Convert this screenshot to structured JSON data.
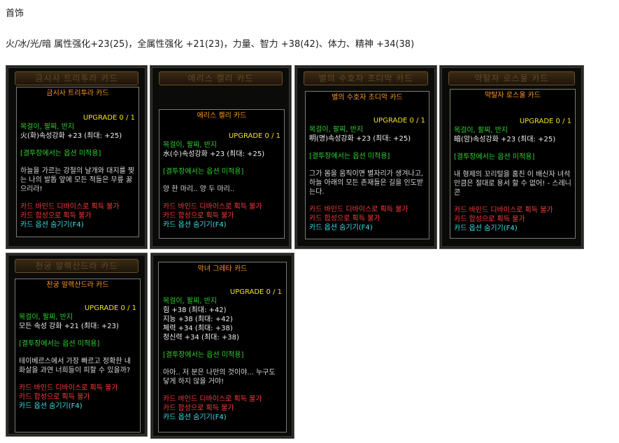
{
  "heading": "首饰",
  "summary": "火/冰/光/暗 属性强化+23(25)，全属性强化 +21(23)，力量、智力 +38(42)、体力、精神 +34(38)",
  "cards": [
    {
      "frame_title": "금시사 트리투라 카드",
      "name": "금시사 트리투라 카드",
      "upgrade": "UPGRADE 0 / 1",
      "slots": "목걸이, 팔찌, 반지",
      "stats": [
        "火(화)속성강화 +23 (최대: +25)"
      ],
      "note": "[결투장에서는 옵션 미적용]",
      "desc": "하늘을 가르는 강철의 날개와 대지를 찢는 나의 발톱 앞에 모든 적들은 무릎 꿇으리라!",
      "bind": "카드 바인드 디바이스로 획득 불가",
      "synth": "카드 합성으로 획득 불가",
      "hide": "카드 옵션 숨기기(F4)"
    },
    {
      "frame_title": "에리스 켈리 카드",
      "name": "에리스 켈리 카드",
      "upgrade": "UPGRADE 0 / 1",
      "slots": "목걸이, 팔찌, 반지",
      "stats": [
        "水(수)속성강화 +23 (최대: +25)"
      ],
      "note": "[결투장에서는 옵션 미적용]",
      "desc": "양 한 마리.. 양 두 마리..",
      "bind": "카드 바인드 디바이스로 획득 불가",
      "synth": "카드 합성으로 획득 불가",
      "hide": "카드 옵션 숨기기(F4)"
    },
    {
      "frame_title": "별의 수호자 조디악 카드",
      "name": "별의 수호자 조디악 카드",
      "upgrade": "UPGRADE 0 / 1",
      "slots": "목걸이, 팔찌, 반지",
      "stats": [
        "明(명)속성강화 +23 (최대: +25)"
      ],
      "note": "[결투장에서는 옵션 미적용]",
      "desc": "그가 몸을 움직이면 별자리가 생겨나고, 하늘 아래의 모든 존재들은 길을 인도받는다.",
      "bind": "카드 바인드 디바이스로 획득 불가",
      "synth": "카드 합성으로 획득 불가",
      "hide": "카드 옵션 숨기기(F4)"
    },
    {
      "frame_title": "약탈자 로스울 카드",
      "name": "약탈자 로스울 카드",
      "upgrade": "UPGRADE 0 / 1",
      "slots": "목걸이, 팔찌, 반지",
      "stats": [
        "暗(암)속성강화 +23 (최대: +25)"
      ],
      "note": "[결투장에서는 옵션 미적용]",
      "desc": "내 형제의 꼬리털을 훔친 이 배신자 녀석만큼은 절대로 용서 할 수 없어! - 스레니콘",
      "bind": "카드 바인드 디바이스로 획득 불가",
      "synth": "카드 합성으로 획득 불가",
      "hide": "카드 옵션 숨기기(F4)"
    },
    {
      "frame_title": "천궁 알렉산드라 카드",
      "name": "천궁 알렉산드라 카드",
      "upgrade": "UPGRADE 0 / 1",
      "slots": "목걸이, 팔찌, 반지",
      "stats": [
        "모든 속성 강화 +21 (최대: +23)"
      ],
      "note": "[결투장에서는 옵션 미적용]",
      "desc": "테이베르스에서 가장 빠르고 정확한 내 화살을 과연 너희들이 피할 수 있을까?",
      "bind": "카드 바인드 디바이스로 획득 불가",
      "synth": "카드 합성으로 획득 불가",
      "hide": "카드 옵션 숨기기(F4)"
    },
    {
      "frame_title": "악녀 그레타 카드",
      "name": "악녀 그레타 카드",
      "upgrade": "UPGRADE 0 / 1",
      "slots": "목걸이, 팔찌, 반지",
      "stats": [
        "힘 +38 (최대: +42)",
        "지능 +38 (최대: +42)",
        "체력 +34 (최대: +38)",
        "정신력 +34 (최대: +38)"
      ],
      "note": "[결투장에서는 옵션 미적용]",
      "desc": "아아.. 저 분은 나만의 것이야... 누구도 닿게 하지 않을 거야!",
      "bind": "카드 바인드 디바이스로 획득 불가",
      "synth": "카드 합성으로 획득 불가",
      "hide": "카드 옵션 숨기기(F4)"
    }
  ]
}
